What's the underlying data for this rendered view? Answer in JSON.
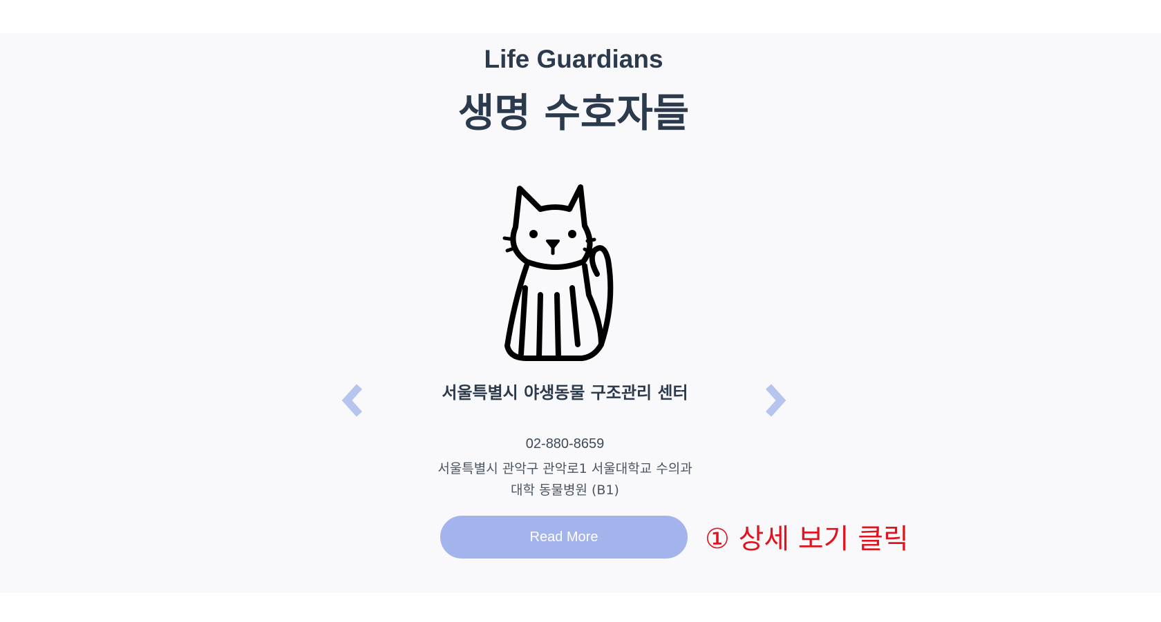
{
  "section": {
    "title_en": "Life Guardians",
    "title_ko": "생명 수호자들"
  },
  "carousel": {
    "prev_icon": "chevron-left-icon",
    "next_icon": "chevron-right-icon",
    "arrow_color": "#b6c5ee",
    "card": {
      "image_icon": "cat-icon",
      "title": "서울특별시 야생동물 구조관리 센터",
      "phone": "02-880-8659",
      "address": "서울특별시 관악구 관악로1 서울대학교 수의과대학 동물병원 (B1)",
      "button_label": "Read More",
      "button_color": "#a3b4ec"
    }
  },
  "annotation": {
    "text": "① 상세 보기 클릭",
    "color": "#e0141e"
  }
}
